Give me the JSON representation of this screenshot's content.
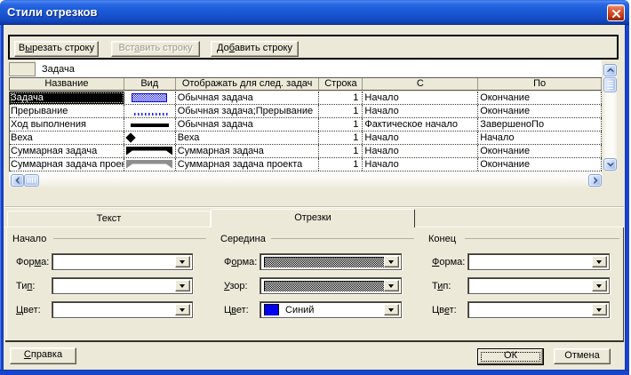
{
  "window": {
    "title": "Стили отрезков",
    "close_icon": "x"
  },
  "colors": {
    "dialog_bg": "#ECE9D8",
    "title_blue": "#1650CC",
    "task_bar_blue": "#2A2AEE",
    "selection_bg": "#000000",
    "swatch_blue": "#0000F2"
  },
  "toolbar": {
    "cut_label": "В[ы]резать строку",
    "paste_label": "Вст[а]вить строку",
    "add_label": "До[б]авить строку"
  },
  "entry_bar": {
    "value": "Задача"
  },
  "table": {
    "columns": [
      "Название",
      "Вид",
      "Отображать для след. задач",
      "Строка",
      "С",
      "По"
    ],
    "rows": [
      {
        "name": "Задача",
        "bar": "task",
        "show_for": "Обычная задача",
        "row": "1",
        "from": "Начало",
        "to": "Окончание",
        "selected": true
      },
      {
        "name": "Прерывание",
        "bar": "interruption",
        "show_for": "Обычная задача;Прерывание",
        "row": "1",
        "from": "Начало",
        "to": "Окончание",
        "selected": false
      },
      {
        "name": "Ход выполнения",
        "bar": "progress",
        "show_for": "Обычная задача",
        "row": "1",
        "from": "Фактическое начало",
        "to": "ЗавершеноПо",
        "selected": false
      },
      {
        "name": "Веха",
        "bar": "milestone",
        "show_for": "Веха",
        "row": "1",
        "from": "Начало",
        "to": "Начало",
        "selected": false
      },
      {
        "name": "Суммарная задача",
        "bar": "summary",
        "show_for": "Суммарная задача",
        "row": "1",
        "from": "Начало",
        "to": "Окончание",
        "selected": false
      },
      {
        "name": "Суммарная задача проекта",
        "bar": "summary-project",
        "show_for": "Суммарная задача проекта",
        "row": "1",
        "from": "Начало",
        "to": "Окончание",
        "selected": false
      }
    ]
  },
  "tabs": [
    {
      "label": "Текст",
      "active": false
    },
    {
      "label": "Отрезки",
      "active": true
    }
  ],
  "sections": {
    "start": {
      "title": "Начало",
      "shape_label": "Фор[м]а:",
      "shape_value": "",
      "type_label": "Ти[п]:",
      "type_value": "",
      "color_label": "[Ц]вет:",
      "color_value": ""
    },
    "middle": {
      "title": "Середина",
      "shape_label": "Ф[о]рма:",
      "shape_value": "pattern",
      "pattern_label": "[У]зор:",
      "pattern_value": "pattern",
      "color_label": "Ц[в]ет:",
      "color_value": "Синий"
    },
    "end": {
      "title": "Конец",
      "shape_label": "[Ф]орма:",
      "shape_value": "",
      "type_label": "Т[и]п:",
      "type_value": "",
      "color_label": "Цв[е]т:",
      "color_value": ""
    }
  },
  "footer": {
    "help_label": "[С]правка",
    "ok_label": "ОК",
    "cancel_label": "Отмена"
  }
}
